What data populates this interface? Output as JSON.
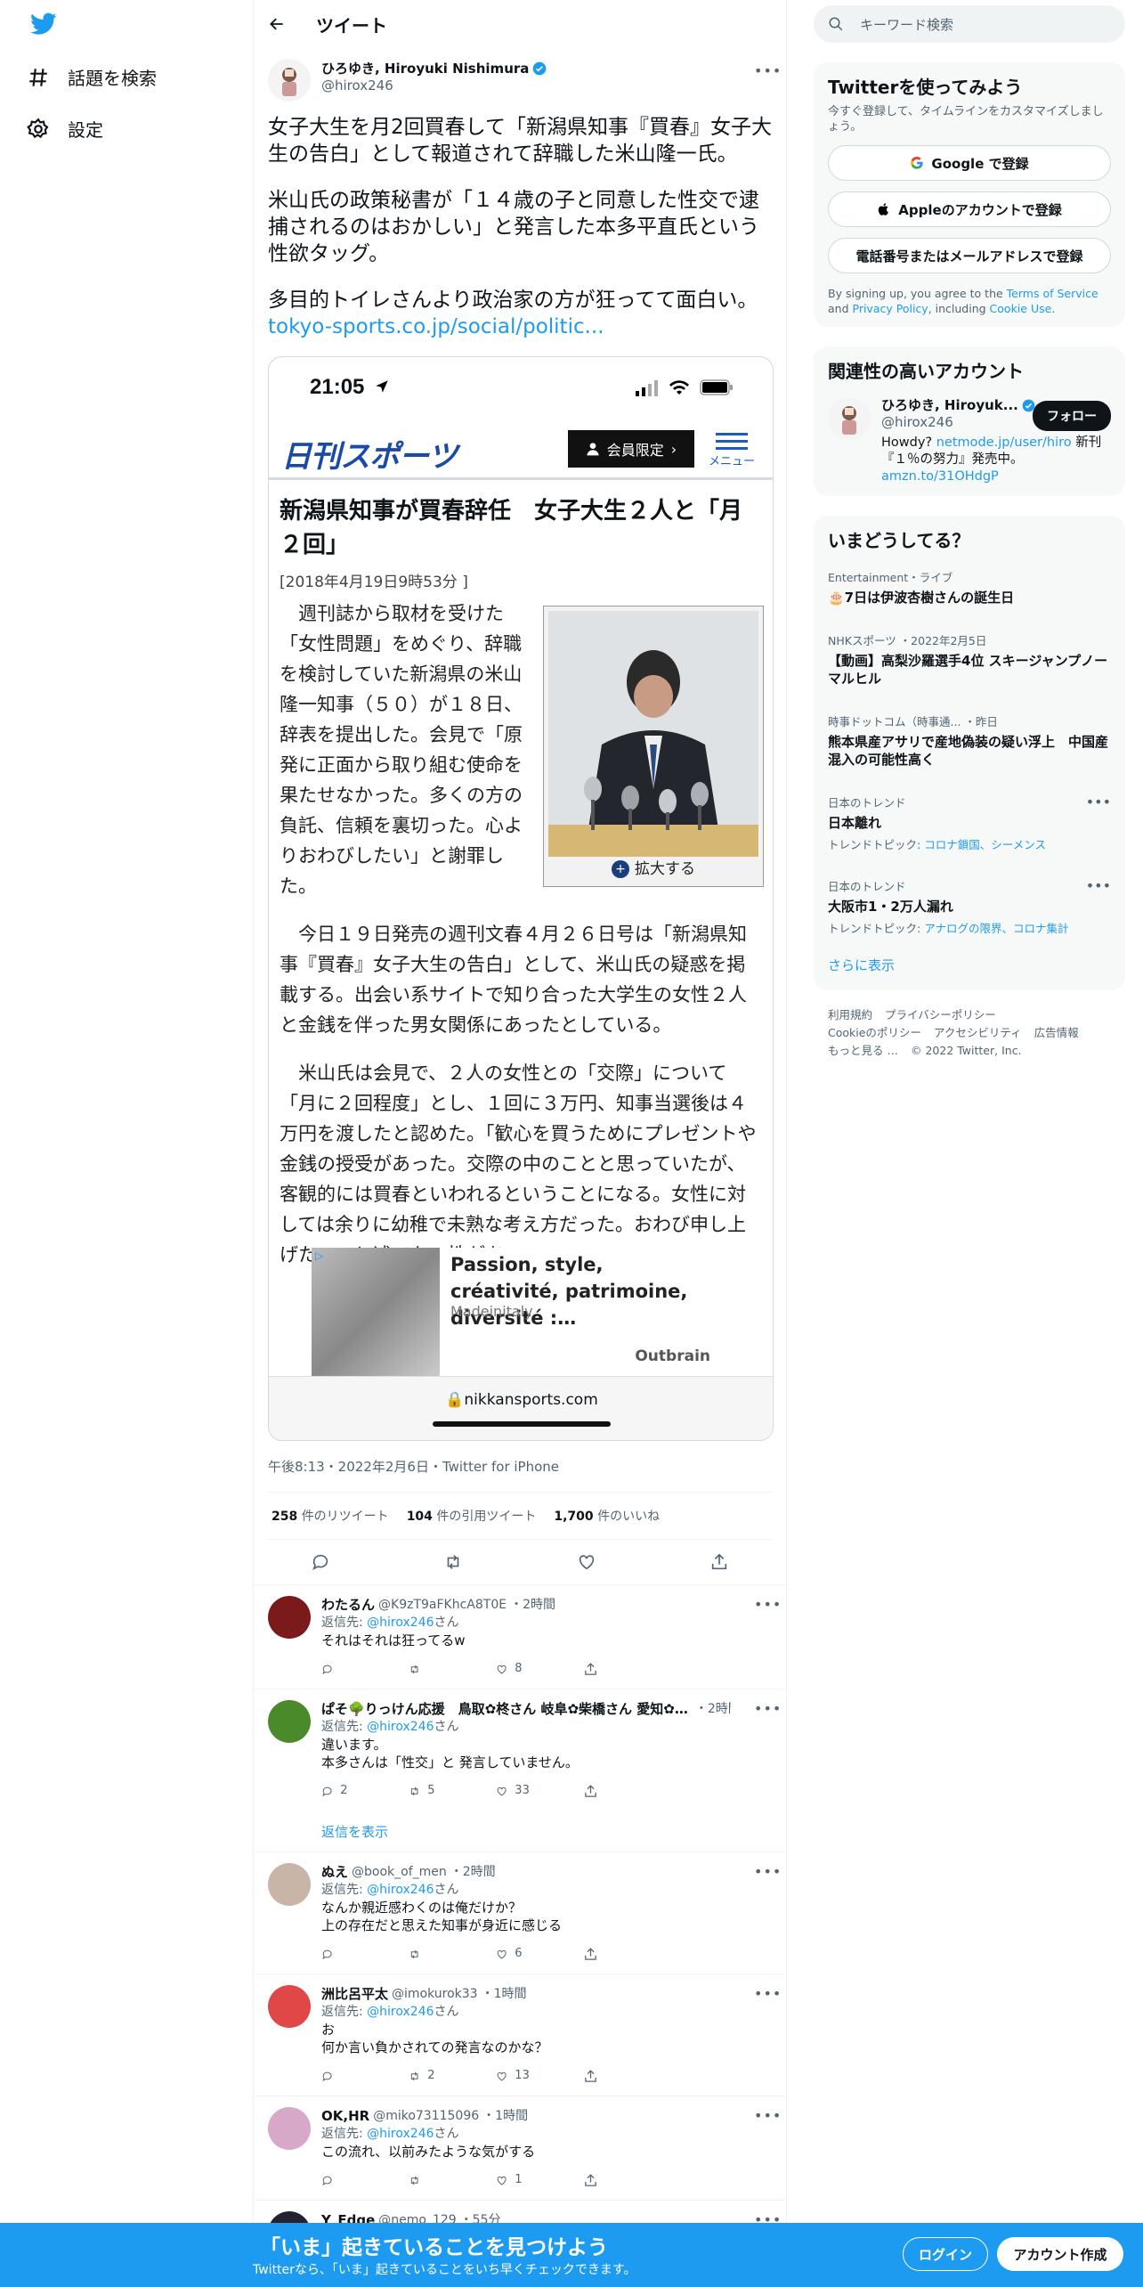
{
  "nav": {
    "explore_label": "話題を検索",
    "settings_label": "設定"
  },
  "header": {
    "title": "ツイート"
  },
  "tweet": {
    "display_name": "ひろゆき, Hiroyuki Nishimura",
    "handle": "@hirox246",
    "paragraphs": [
      "女子大生を月2回買春して「新潟県知事『買春』女子大生の告白」として報道されて辞職した米山隆一氏。",
      "米山氏の政策秘書が「１４歳の子と同意した性交で逮捕されるのはおかしい」と発言した本多平直氏という性欲タッグ。",
      "多目的トイレさんより政治家の方が狂ってて面白い。"
    ],
    "link": "tokyo-sports.co.jp/social/politic...",
    "timestamp": "午後8:13・2022年2月6日・Twitter for iPhone",
    "retweets": "258",
    "retweets_label": "件のリツイート",
    "quotes": "104",
    "quotes_label": "件の引用ツイート",
    "likes": "1,700",
    "likes_label": "件のいいね"
  },
  "media": {
    "phone_time": "21:05",
    "site_logo": "日刊スポーツ",
    "member_button": "会員限定",
    "menu_label": "メニュー",
    "headline": "新潟県知事が買春辞任　女子大生２人と「月２回」",
    "date": "[2018年4月19日9時53分 ]",
    "enlarge": "拡大する",
    "body": [
      "週刊誌から取材を受けた「女性問題」をめぐり、辞職を検討していた新潟県の米山隆一知事（５０）が１８日、辞表を提出した。会見で「原発に正面から取り組む使命を果たせなかった。多くの方の負託、信頼を裏切った。心よりおわびしたい」と謝罪した。",
      "今日１９日発売の週刊文春４月２６日号は「新潟県知事『買春』女子大生の告白」として、米山氏の疑惑を掲載する。出会い系サイトで知り合った大学生の女性２人と金銭を伴った男女関係にあったとしている。",
      "米山氏は会見で、２人の女性との「交際」について「月に２回程度」とし、１回に３万円、知事当選後は４万円を渡したと認めた。「歓心を買うためにプレゼントや金銭の授受があった。交際の中のことと思っていたが、客観的には買春といわれるということになる。女性に対しては余りに幼稚で未熟な考え方だった。おわび申し上げたい」と述べた。性があ..."
    ],
    "ad_title": "Passion, style, créativité, patrimoine, diversité :…",
    "ad_source": "Madeinitaly",
    "ad_brand": "Outbrain",
    "url": "nikkansports.com"
  },
  "replies": [
    {
      "display_name": "わたるん",
      "handle": "@K9zT9aFKhcA8T0E",
      "time": "・2時間",
      "reply_to_label": "返信先: ",
      "reply_to": "@hirox246",
      "reply_to_suffix": "さん",
      "text": [
        "それはそれは狂ってるw"
      ],
      "replies": "",
      "retweets": "",
      "likes": "8"
    },
    {
      "display_name": "ぱそ🌳りっけん応援　鳥取✿柊さん 岐阜✿柴橋さん 愛知✿…",
      "handle": "",
      "time": "・2時間",
      "reply_to_label": "返信先: ",
      "reply_to": "@hirox246",
      "reply_to_suffix": "さん",
      "text": [
        "違います。",
        "本多さんは「性交」と 発言していません。"
      ],
      "replies": "2",
      "retweets": "5",
      "likes": "33",
      "show_replies": "返信を表示"
    },
    {
      "display_name": "ぬえ",
      "handle": "@book_of_men",
      "time": "・2時間",
      "reply_to_label": "返信先: ",
      "reply_to": "@hirox246",
      "reply_to_suffix": "さん",
      "text": [
        "なんか親近感わくのは俺だけか？",
        "上の存在だと思えた知事が身近に感じる"
      ],
      "replies": "",
      "retweets": "",
      "likes": "6"
    },
    {
      "display_name": "洲比呂平太",
      "handle": "@imokurok33",
      "time": "・1時間",
      "reply_to_label": "返信先: ",
      "reply_to": "@hirox246",
      "reply_to_suffix": "さん",
      "text": [
        "お",
        "何か言い負かされての発言なのかな？"
      ],
      "replies": "",
      "retweets": "2",
      "likes": "13"
    },
    {
      "display_name": "OK,HR",
      "handle": "@miko73115096",
      "time": "・1時間",
      "reply_to_label": "返信先: ",
      "reply_to": "@hirox246",
      "reply_to_suffix": "さん",
      "text": [
        "この流れ、以前みたような気がする"
      ],
      "replies": "",
      "retweets": "",
      "likes": "1"
    },
    {
      "display_name": "Y_Edge",
      "handle": "@nemo_129",
      "time": "・55分",
      "reply_to_label": "",
      "reply_to": "",
      "reply_to_suffix": "",
      "text": [],
      "replies": "",
      "retweets": "",
      "likes": ""
    }
  ],
  "sidebar": {
    "search_placeholder": "キーワード検索",
    "signup": {
      "title": "Twitterを使ってみよう",
      "sub": "今すぐ登録して、タイムラインをカスタマイズしましょう。",
      "google": "Google で登録",
      "apple": "Appleのアカウントで登録",
      "phone": "電話番号またはメールアドレスで登録",
      "legal_pre": "By signing up, you agree to the ",
      "terms": "Terms of Service",
      "legal_and": " and ",
      "privacy": "Privacy Policy",
      "legal_including": ", including ",
      "cookie": "Cookie Use",
      "legal_end": "."
    },
    "related": {
      "title": "関連性の高いアカウント",
      "name": "ひろゆき, Hiroyuk...",
      "handle": "@hirox246",
      "follow": "フォロー",
      "bio_pre": "Howdy? ",
      "bio_link1": "netmode.jp/user/hiro",
      "bio_mid": " 新刊『１％の努力』発売中。",
      "bio_link2": "amzn.to/31OHdgP"
    },
    "trends": {
      "title": "いまどうしてる？",
      "items": [
        {
          "cat": "Entertainment・ライブ",
          "title": "🎂7日は伊波杏樹さんの誕生日",
          "topics": ""
        },
        {
          "cat": "NHKスポーツ ・2022年2月5日",
          "title": "【動画】高梨沙羅選手4位 スキージャンプノーマルヒル",
          "topics": ""
        },
        {
          "cat": "時事ドットコム（時事通... ・昨日",
          "title": "熊本県産アサリで産地偽装の疑い浮上　中国産混入の可能性高く",
          "topics": ""
        },
        {
          "cat": "日本のトレンド",
          "title": "日本離れ",
          "topics_label": "トレンドトピック: ",
          "topics": "コロナ鎖国、シーメンス"
        },
        {
          "cat": "日本のトレンド",
          "title": "大阪市1・2万人漏れ",
          "topics_label": "トレンドトピック: ",
          "topics": "アナログの限界、コロナ集計"
        }
      ],
      "more": "さらに表示"
    },
    "footer": [
      "利用規約",
      "プライバシーポリシー",
      "Cookieのポリシー",
      "アクセシビリティ",
      "広告情報",
      "もっと見る …",
      "© 2022 Twitter, Inc."
    ]
  },
  "bottom_bar": {
    "headline": "「いま」起きていることを見つけよう",
    "sub": "Twitterなら、「いま」起きていることをいち早くチェックできます。",
    "login": "ログイン",
    "signup": "アカウント作成"
  },
  "colors": {
    "accent": "#1d9bf0",
    "text": "#0f1419",
    "secondary": "#536471",
    "border": "#eff3f4"
  }
}
